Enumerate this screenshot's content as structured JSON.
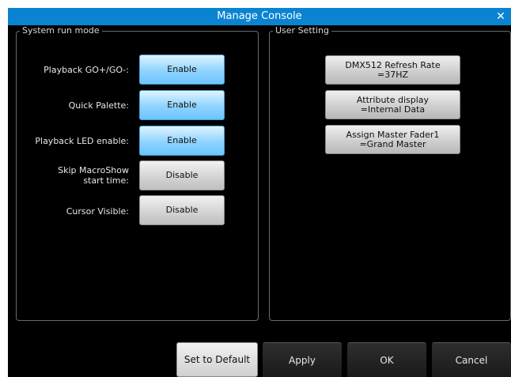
{
  "window": {
    "title": "Manage Console",
    "close_glyph": "✕"
  },
  "system_run_mode": {
    "title": "System run mode",
    "rows": [
      {
        "label": "Playback GO+/GO-:",
        "value": "Enable"
      },
      {
        "label": "Quick Palette:",
        "value": "Enable"
      },
      {
        "label": "Playback LED enable:",
        "value": "Enable"
      },
      {
        "label": "Skip MacroShow start time:",
        "label_line1": "Skip MacroShow",
        "label_line2": "start time:",
        "value": "Disable"
      },
      {
        "label": "Cursor Visible:",
        "value": "Disable"
      }
    ]
  },
  "user_setting": {
    "title": "User Setting",
    "buttons": [
      {
        "line1": "DMX512 Refresh Rate",
        "line2": "=37HZ"
      },
      {
        "line1": "Attribute display",
        "line2": "=Internal Data"
      },
      {
        "line1": "Assign Master Fader1",
        "line2": "=Grand Master"
      }
    ]
  },
  "footer": {
    "set_default": "Set to Default",
    "apply": "Apply",
    "ok": "OK",
    "cancel": "Cancel"
  },
  "colors": {
    "title_bar": "#0a84d0",
    "enable_button": "#8fd3ff",
    "disable_button": "#d4d4d4",
    "background": "#000000"
  }
}
